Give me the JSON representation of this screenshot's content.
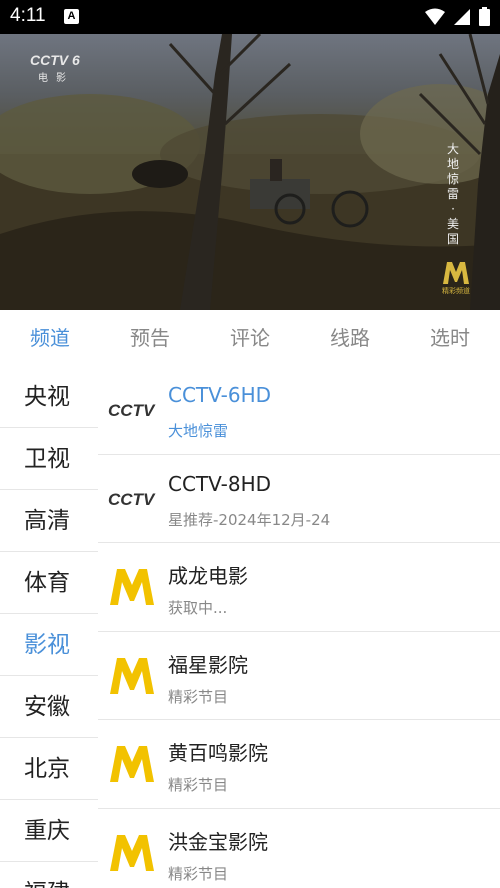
{
  "status_bar": {
    "time": "4:11",
    "notification_icon": "A"
  },
  "video": {
    "channel_logo_line1": "CCTV 6",
    "channel_logo_line2": "电影",
    "title_vertical": "大地惊雷·美国",
    "watermark_brand": "M",
    "watermark_text": "精彩频道"
  },
  "tabs": [
    {
      "label": "频道",
      "active": true
    },
    {
      "label": "预告",
      "active": false
    },
    {
      "label": "评论",
      "active": false
    },
    {
      "label": "线路",
      "active": false
    },
    {
      "label": "选时",
      "active": false
    }
  ],
  "categories": [
    {
      "label": "央视"
    },
    {
      "label": "卫视"
    },
    {
      "label": "高清"
    },
    {
      "label": "体育"
    },
    {
      "label": "影视"
    },
    {
      "label": "安徽"
    },
    {
      "label": "北京"
    },
    {
      "label": "重庆"
    },
    {
      "label": "福建"
    }
  ],
  "active_category": "影视",
  "channels": [
    {
      "name": "CCTV-6HD",
      "program": "大地惊雷",
      "logo": "cctv-logo",
      "active": true
    },
    {
      "name": "CCTV-8HD",
      "program": "星推荐-2024年12月-24",
      "logo": "cctv-logo",
      "active": false
    },
    {
      "name": "成龙电影",
      "program": "获取中...",
      "logo": "m-logo",
      "active": false
    },
    {
      "name": "福星影院",
      "program": "精彩节目",
      "logo": "m-logo",
      "active": false
    },
    {
      "name": "黄百鸣影院",
      "program": "精彩节目",
      "logo": "m-logo",
      "active": false
    },
    {
      "name": "洪金宝影院",
      "program": "精彩节目",
      "logo": "m-logo",
      "active": false
    }
  ],
  "colors": {
    "accent": "#4a90d9",
    "m_logo": "#f2c200"
  }
}
